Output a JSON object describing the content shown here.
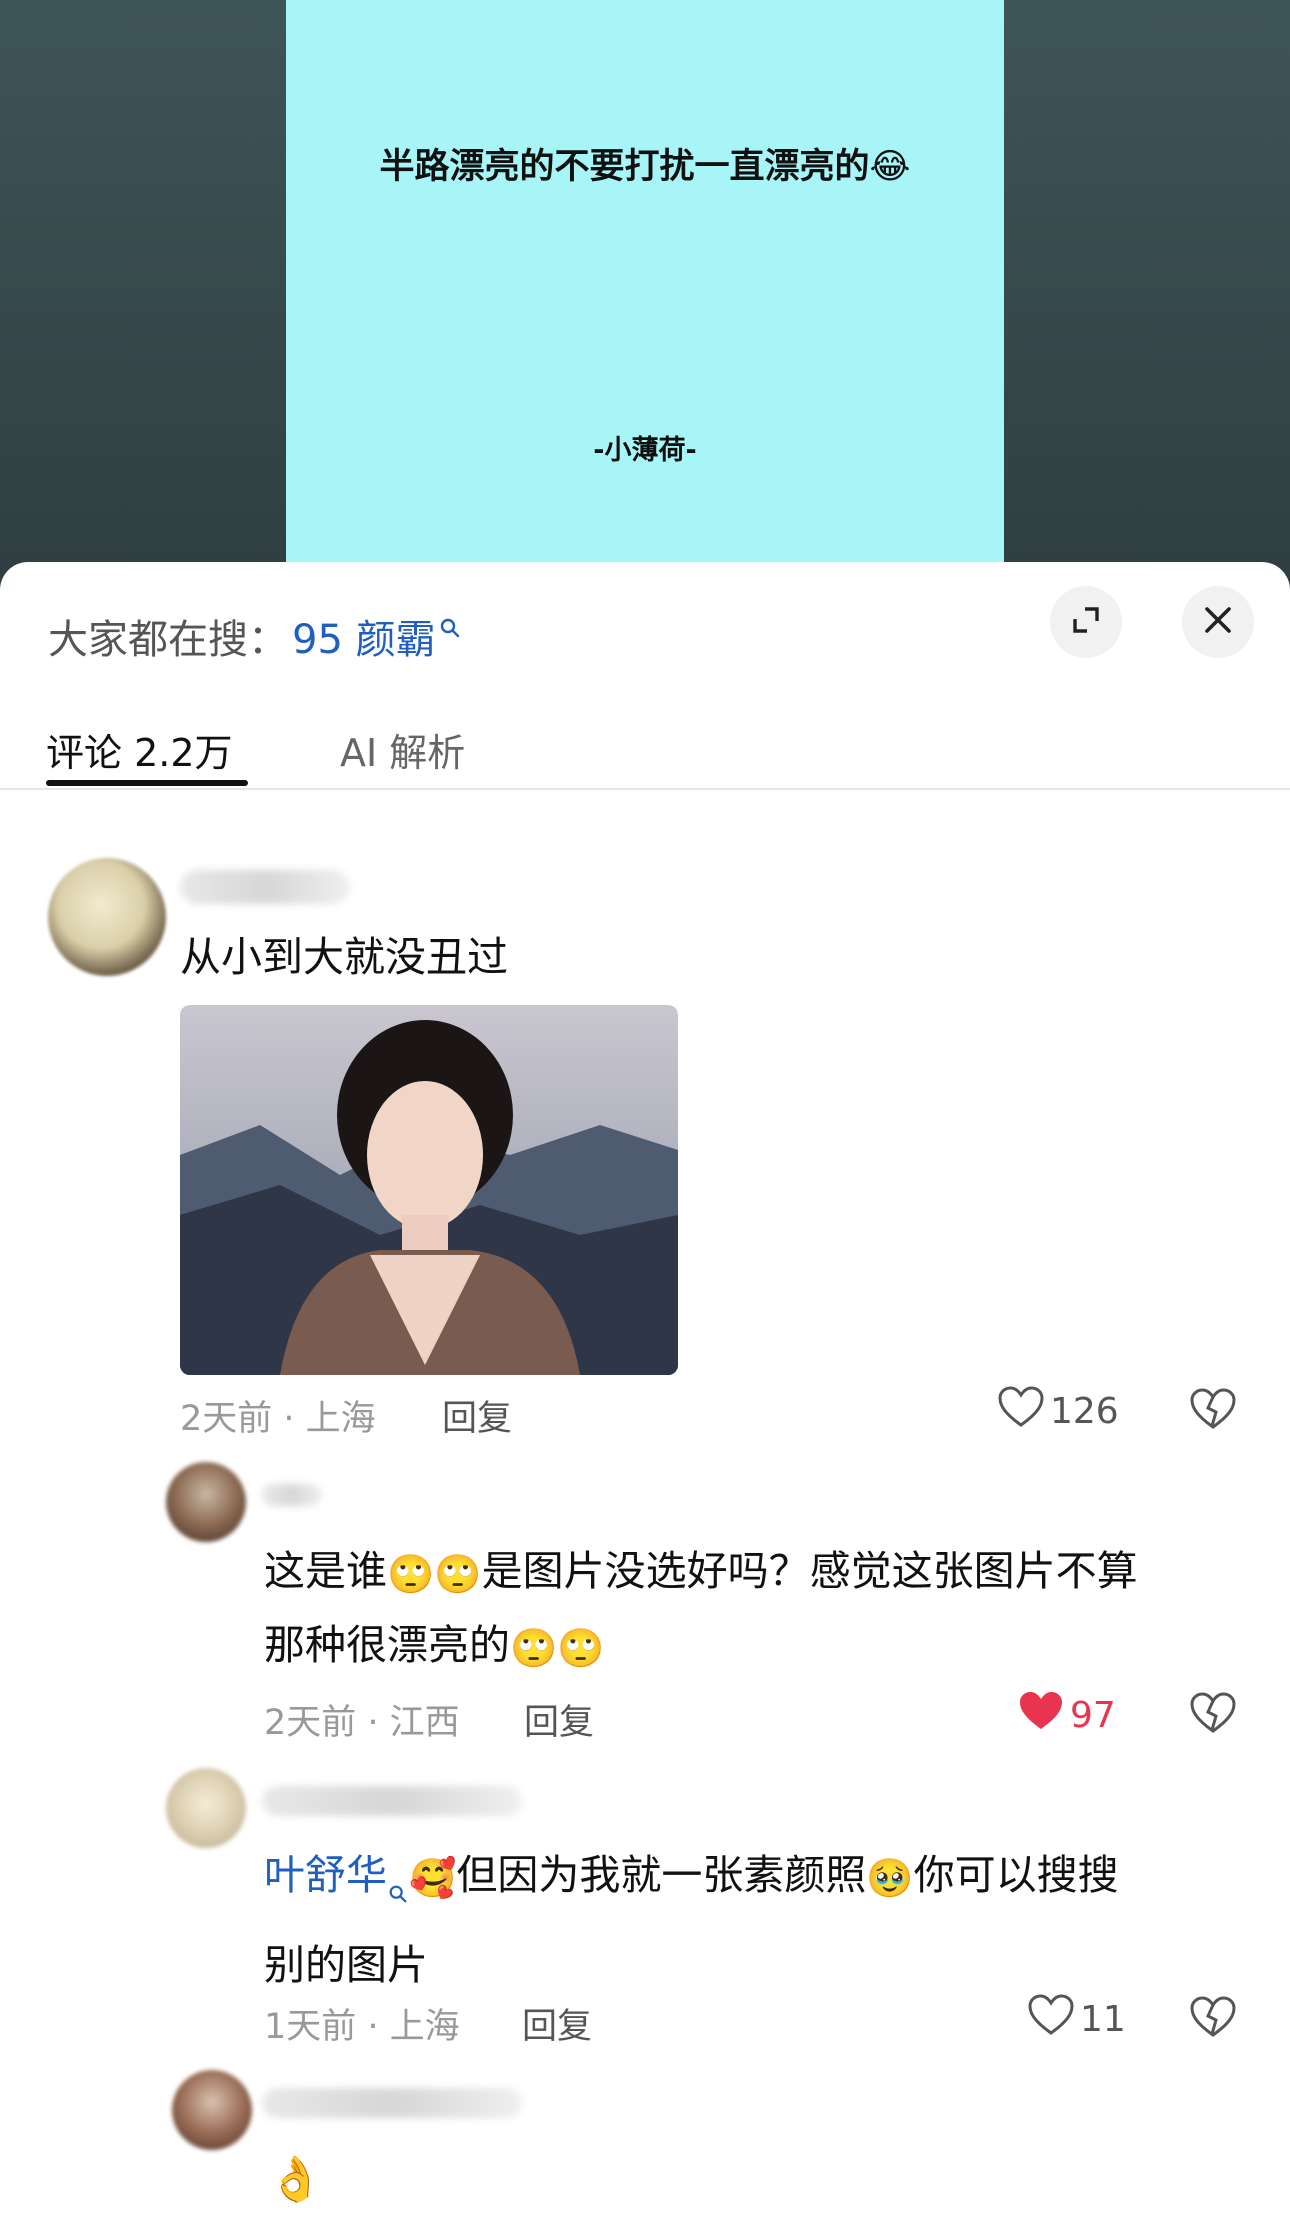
{
  "video": {
    "title": "半路漂亮的不要打扰一直漂亮的😂",
    "signature": "-小薄荷-"
  },
  "sheet": {
    "search_prefix": "大家都在搜：",
    "search_term": "95 颜霸",
    "tabs": [
      {
        "label": "评论 2.2万",
        "active": true
      },
      {
        "label": "AI 解析",
        "active": false
      }
    ]
  },
  "comments": [
    {
      "text": "从小到大就没丑过",
      "meta": "2天前 · 上海",
      "reply": "回复",
      "likes": "126",
      "liked": false
    },
    {
      "text_a": "这是谁",
      "emoji_a": "🙄🙄",
      "text_b": "是图片没选好吗？感觉这张图片不算",
      "text_c": "那种很漂亮的",
      "emoji_c": "🙄🙄",
      "meta": "2天前 · 江西",
      "reply": "回复",
      "likes": "97",
      "liked": true
    },
    {
      "mention": "叶舒华",
      "emoji_a": "🥰",
      "text_a": "但因为我就一张素颜照",
      "emoji_b": "🥹",
      "text_b": "你可以搜搜",
      "text_c": "别的图片",
      "meta": "1天前 · 上海",
      "reply": "回复",
      "likes": "11",
      "liked": false
    },
    {
      "emoji": "👌"
    }
  ],
  "colors": {
    "accent_blue": "#1f5fbf",
    "like_red": "#e8344e",
    "video_bg": "#a8f5f8"
  }
}
